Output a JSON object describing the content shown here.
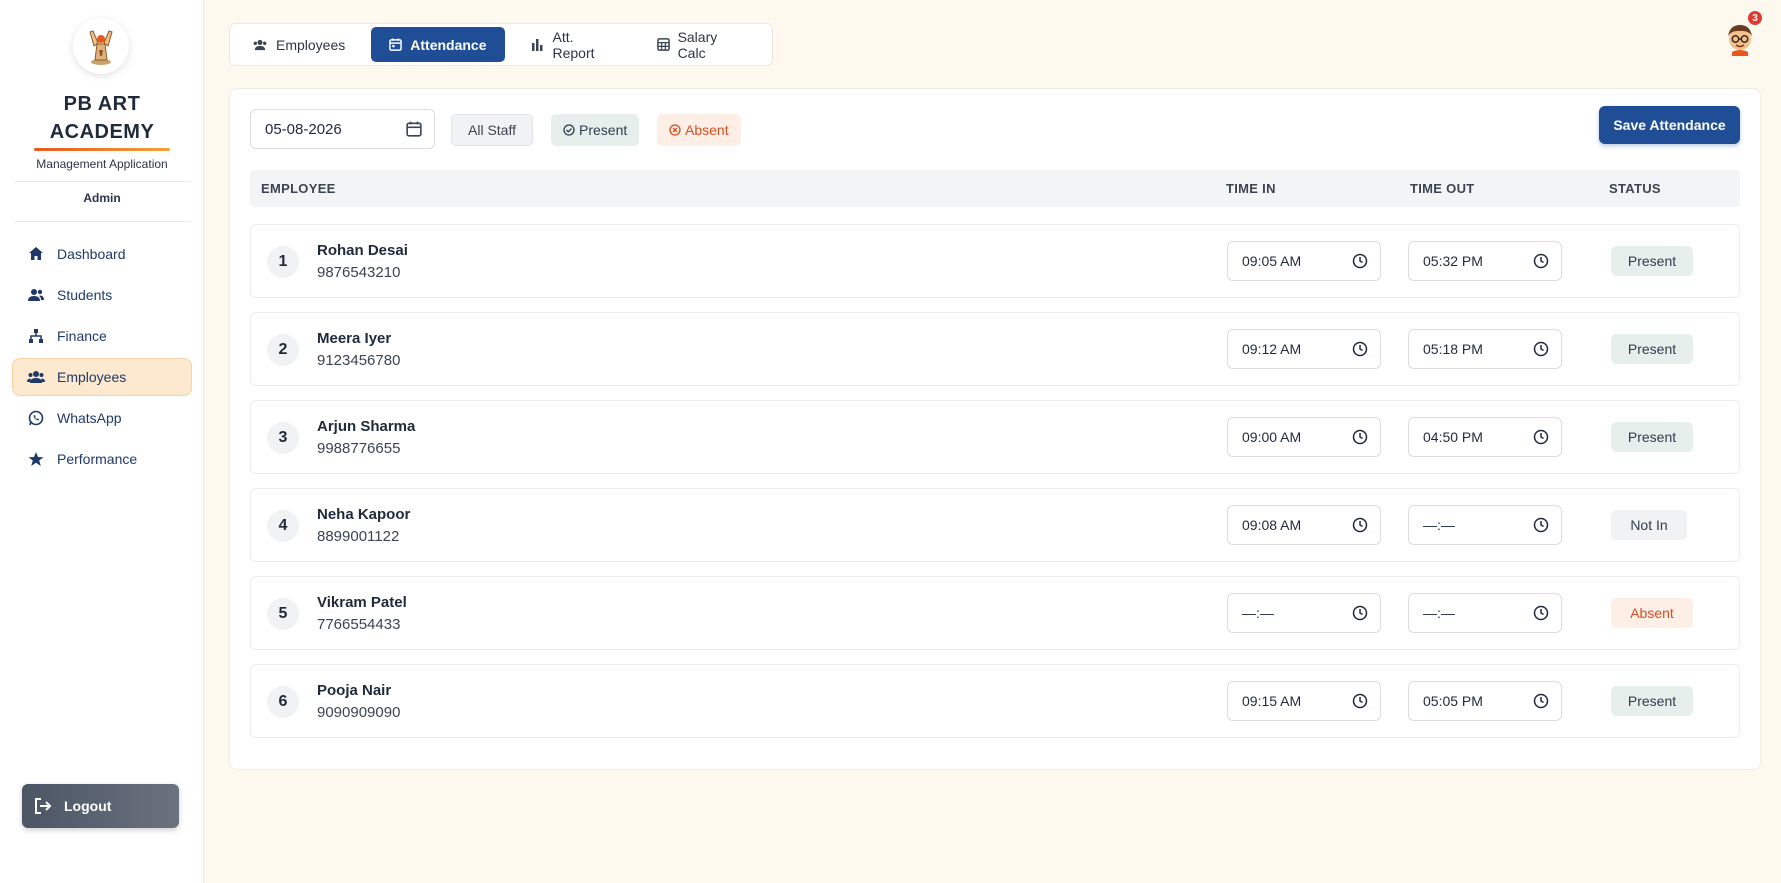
{
  "sidebar": {
    "brand_line1": "PB ART",
    "brand_line2": "ACADEMY",
    "subtitle": "Management Application",
    "role": "Admin",
    "nav": [
      {
        "label": "Dashboard",
        "icon": "home-icon"
      },
      {
        "label": "Students",
        "icon": "users-icon"
      },
      {
        "label": "Finance",
        "icon": "hierarchy-icon"
      },
      {
        "label": "Employees",
        "icon": "group-icon",
        "active": true
      },
      {
        "label": "WhatsApp",
        "icon": "whatsapp-icon"
      },
      {
        "label": "Performance",
        "icon": "star-icon"
      }
    ],
    "logout_label": "Logout"
  },
  "tabs": [
    {
      "label": "Employees",
      "icon": "group-icon"
    },
    {
      "label": "Attendance",
      "icon": "calendar-icon",
      "active": true
    },
    {
      "label": "Att. Report",
      "icon": "bar-chart-icon"
    },
    {
      "label": "Salary Calc",
      "icon": "calculator-icon"
    }
  ],
  "notifications": {
    "count": "3"
  },
  "toolbar": {
    "date": "05-08-2026",
    "filters": {
      "all": "All Staff",
      "present": "Present",
      "absent": "Absent"
    },
    "save_label": "Save Attendance"
  },
  "table": {
    "headers": {
      "employee": "EMPLOYEE",
      "time_in": "TIME IN",
      "time_out": "TIME OUT",
      "status": "STATUS"
    },
    "rows": [
      {
        "num": "1",
        "name": "Rohan Desai",
        "phone": "9876543210",
        "time_in": "09:05 AM",
        "time_out": "05:32 PM",
        "status": "Present",
        "status_type": "present"
      },
      {
        "num": "2",
        "name": "Meera Iyer",
        "phone": "9123456780",
        "time_in": "09:12 AM",
        "time_out": "05:18 PM",
        "status": "Present",
        "status_type": "present"
      },
      {
        "num": "3",
        "name": "Arjun Sharma",
        "phone": "9988776655",
        "time_in": "09:00 AM",
        "time_out": "04:50 PM",
        "status": "Present",
        "status_type": "present"
      },
      {
        "num": "4",
        "name": "Neha Kapoor",
        "phone": "8899001122",
        "time_in": "09:08 AM",
        "time_out": "—:—",
        "status": "Not In",
        "status_type": "notin"
      },
      {
        "num": "5",
        "name": "Vikram Patel",
        "phone": "7766554433",
        "time_in": "—:—",
        "time_out": "—:—",
        "status": "Absent",
        "status_type": "absent"
      },
      {
        "num": "6",
        "name": "Pooja Nair",
        "phone": "9090909090",
        "time_in": "09:15 AM",
        "time_out": "05:05 PM",
        "status": "Present",
        "status_type": "present"
      }
    ]
  },
  "colors": {
    "primary": "#1f4e96",
    "accent": "#e8581d",
    "absent": "#d94e1f",
    "background": "#fef9ee"
  }
}
